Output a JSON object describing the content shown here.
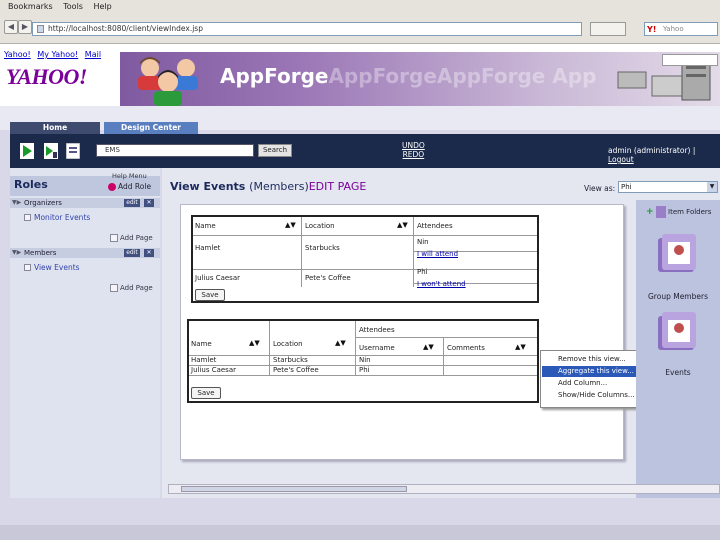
{
  "browser": {
    "menu": [
      "Bookmarks",
      "Tools",
      "Help"
    ],
    "url": "http://localhost:8080/client/viewIndex.jsp",
    "search_placeholder": "Yahoo"
  },
  "yahoo": {
    "links": [
      "Yahoo!",
      "My Yahoo!",
      "Mail"
    ],
    "logo": "YAHOO!"
  },
  "banner": {
    "brand": "AppForge",
    "ghost": "AppForgeAppForge App"
  },
  "tabs": {
    "home": "Home",
    "design": "Design Center"
  },
  "toolbar": {
    "search_value": "EMS",
    "search_button": "Search",
    "undo": "UNDO",
    "redo": "REDO",
    "user_prefix": "admin (administrator)  |",
    "logout": "Logout"
  },
  "roles": {
    "title": "Roles",
    "help_menu": "Help Menu",
    "add_role": "Add Role",
    "groups": [
      {
        "name": "Organizers",
        "edit": "edit",
        "pages": [
          "Monitor Events"
        ],
        "add_page": "Add Page"
      },
      {
        "name": "Members",
        "edit": "edit",
        "pages": [
          "View Events"
        ],
        "add_page": "Add Page"
      }
    ]
  },
  "main": {
    "title": "View Events",
    "subtitle": "(Members)",
    "edit_link": "EDIT PAGE",
    "view_as_label": "View as:",
    "view_as_value": "Phi"
  },
  "table1": {
    "headers": [
      "Name",
      "Location",
      "Attendees"
    ],
    "rows": [
      {
        "name": "Hamlet",
        "location": "Starbucks",
        "attendees": [
          "Nin",
          "I will attend"
        ]
      },
      {
        "name": "Julius Caesar",
        "location": "Pete's Coffee",
        "attendees": [
          "Phi",
          "I won't attend"
        ]
      }
    ],
    "save": "Save"
  },
  "table2": {
    "headers": [
      "Name",
      "Location",
      "Attendees"
    ],
    "sub_headers": [
      "Username",
      "Comments"
    ],
    "rows": [
      {
        "name": "Hamlet",
        "location": "Starbucks",
        "username": "Nin",
        "comments": ""
      },
      {
        "name": "Julius Caesar",
        "location": "Pete's Coffee",
        "username": "Phi",
        "comments": ""
      }
    ],
    "save": "Save"
  },
  "context_menu": {
    "items": [
      "Remove this view...",
      "Aggregate this view...",
      "Add Column...",
      "Show/Hide Columns..."
    ],
    "highlighted": 1
  },
  "right_panel": {
    "item_folders": "Item Folders",
    "folders": [
      "Group Members",
      "Events"
    ]
  },
  "colors": {
    "app_header": "#1b2a4a",
    "accent_purple": "#7b0099",
    "menu_highlight": "#2a59b8"
  }
}
